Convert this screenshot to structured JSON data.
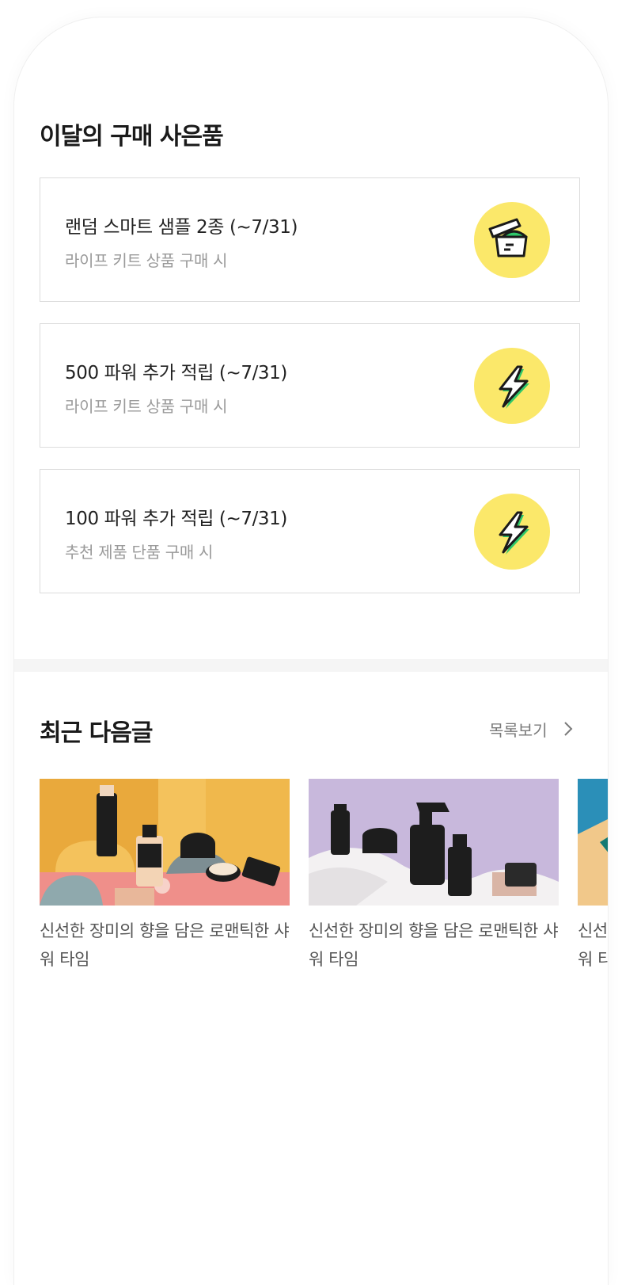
{
  "gifts": {
    "title": "이달의 구매 사은품",
    "items": [
      {
        "title": "랜덤 스마트 샘플 2종 (~7/31)",
        "sub": "라이프 키트 상품 구매 시",
        "icon": "sample-jar-icon"
      },
      {
        "title": "500 파워 추가 적립 (~7/31)",
        "sub": "라이프 키트 상품 구매 시",
        "icon": "lightning-icon"
      },
      {
        "title": "100 파워 추가 적립 (~7/31)",
        "sub": "추천 제품 단품 구매 시",
        "icon": "lightning-icon"
      }
    ]
  },
  "recent": {
    "title": "최근 다음글",
    "more_label": "목록보기",
    "posts": [
      {
        "title": "신선한 장미의 향을 담은 로맨틱한 샤워 타임"
      },
      {
        "title": "신선한 장미의 향을 담은 로맨틱한 샤워 타임"
      },
      {
        "title": "신선한 장미의 향을 담은 로맨틱한 샤워 타임"
      }
    ]
  },
  "colors": {
    "icon_bg": "#fbe86a",
    "accent_green": "#2fc86a",
    "card_border": "#dcdcdc"
  }
}
